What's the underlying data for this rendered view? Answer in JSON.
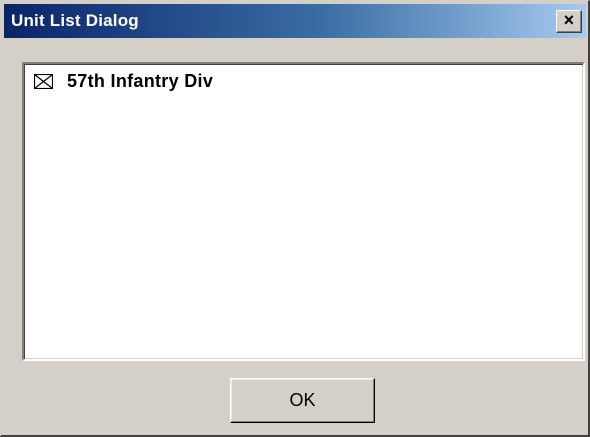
{
  "window": {
    "title": "Unit List Dialog",
    "close_label": "×"
  },
  "list": {
    "items": [
      {
        "label": "57th Infantry Div",
        "icon": "envelope-icon"
      }
    ]
  },
  "footer": {
    "ok_label": "OK"
  },
  "colors": {
    "titlebar_start": "#0a246a",
    "titlebar_end": "#a6caf0",
    "face": "#d4d0c8",
    "list_background": "#ffffff"
  }
}
